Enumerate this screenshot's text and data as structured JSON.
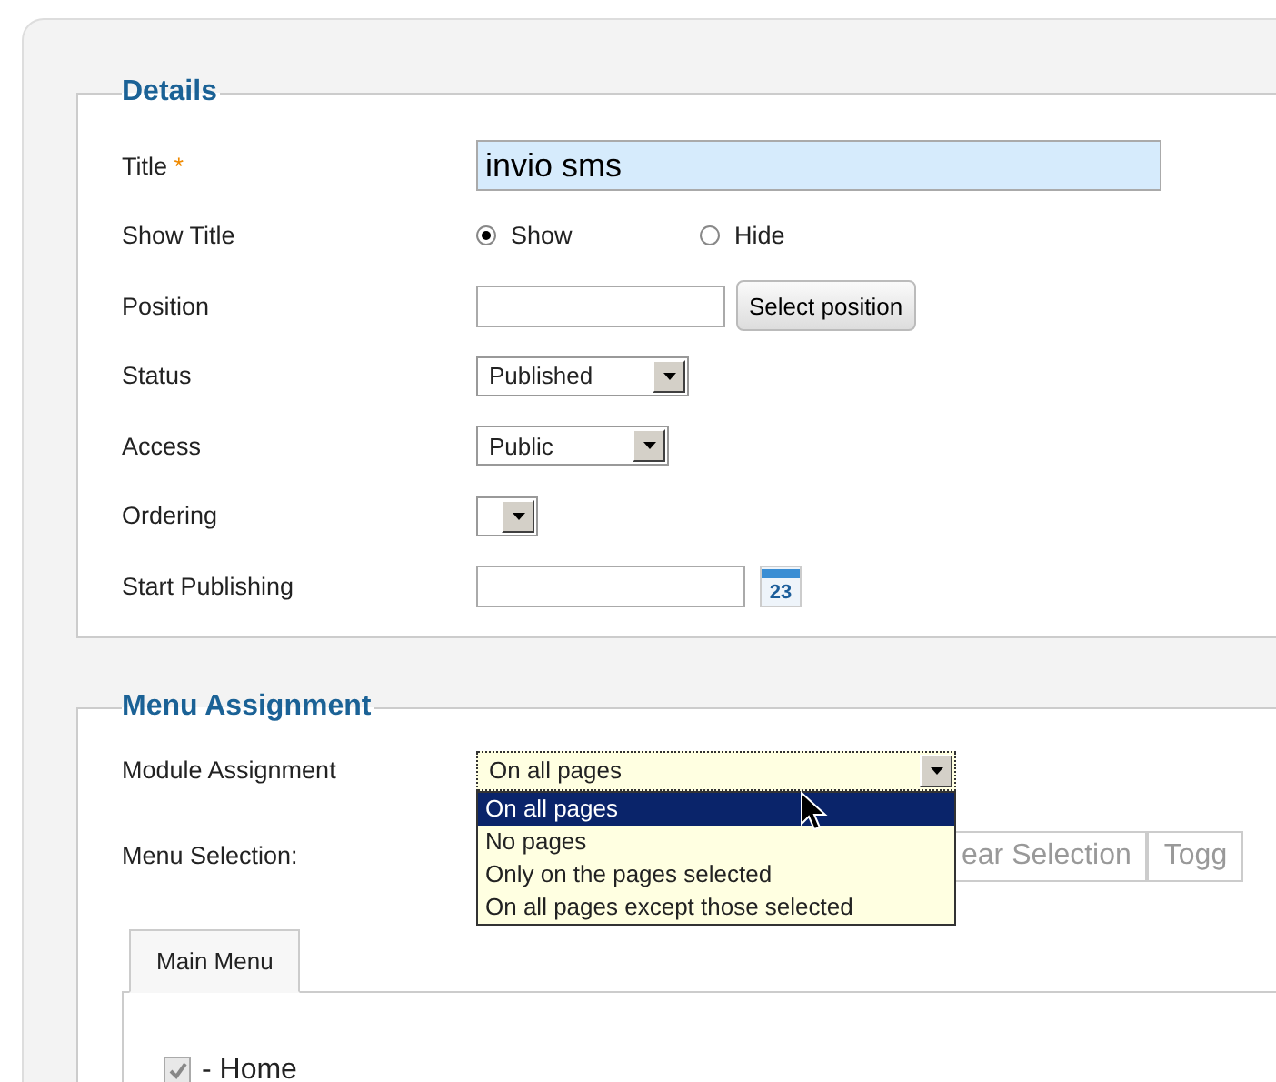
{
  "details": {
    "legend": "Details",
    "title_field": {
      "label": "Title",
      "required_mark": "*",
      "value": "invio sms"
    },
    "show_title": {
      "label": "Show Title",
      "options": [
        {
          "label": "Show",
          "selected": true
        },
        {
          "label": "Hide",
          "selected": false
        }
      ]
    },
    "position": {
      "label": "Position",
      "button": "Select position"
    },
    "selects": [
      {
        "label": "Status",
        "value": "Published"
      },
      {
        "label": "Access",
        "value": "Public"
      },
      {
        "label": "Ordering"
      }
    ],
    "start_publishing": {
      "label": "Start Publishing",
      "calendar": "23"
    }
  },
  "menu_assignment": {
    "legend": "Menu Assignment",
    "module_assignment": {
      "label": "Module Assignment",
      "value": "On all pages",
      "expanded": true,
      "options": [
        {
          "label": "On all pages",
          "selected": true
        },
        {
          "label": "No pages",
          "selected": false
        },
        {
          "label": "Only on the pages selected",
          "selected": false
        },
        {
          "label": "On all pages except those selected",
          "selected": false
        }
      ]
    },
    "menu_selection": {
      "label": "Menu Selection:",
      "buttons": [
        "ear Selection",
        "Togg"
      ]
    },
    "tabs": [
      {
        "label": "Main Menu",
        "selected": true
      }
    ],
    "items": [
      {
        "label": "- Home",
        "checked": true
      }
    ]
  }
}
